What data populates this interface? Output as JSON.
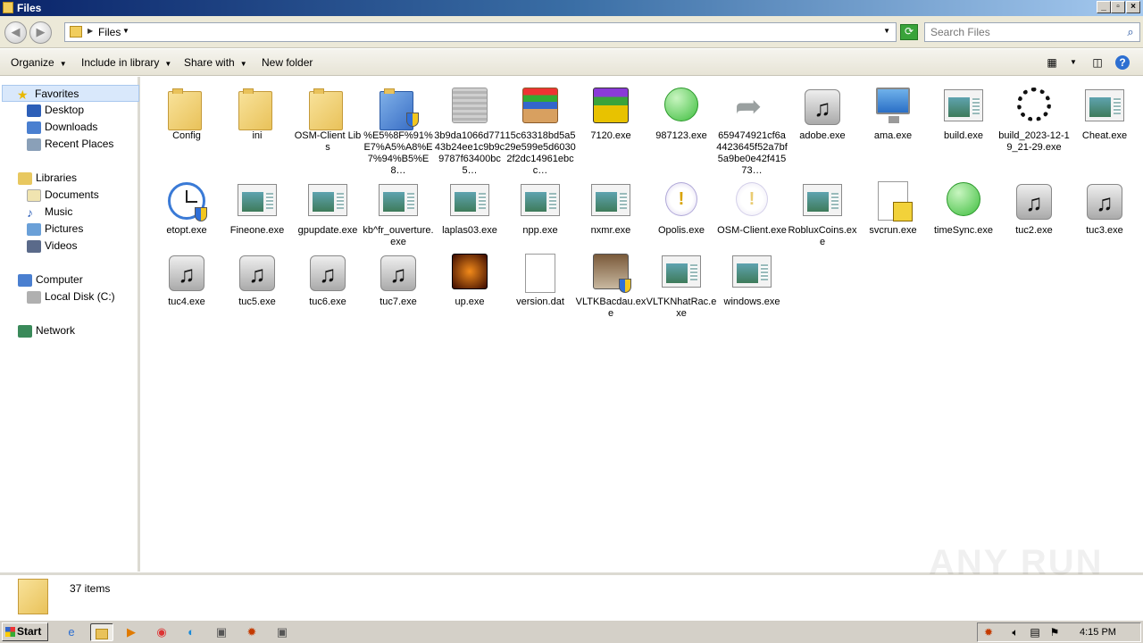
{
  "window": {
    "title": "Files"
  },
  "address": {
    "crumb": "Files",
    "search_placeholder": "Search Files"
  },
  "toolbar": {
    "organize": "Organize",
    "include_in_library": "Include in library",
    "share_with": "Share with",
    "new_folder": "New folder"
  },
  "nav": {
    "favorites": "Favorites",
    "desktop": "Desktop",
    "downloads": "Downloads",
    "recent_places": "Recent Places",
    "libraries": "Libraries",
    "documents": "Documents",
    "music": "Music",
    "pictures": "Pictures",
    "videos": "Videos",
    "computer": "Computer",
    "local_disk": "Local Disk (C:)",
    "network": "Network"
  },
  "files": [
    {
      "name": "Config",
      "icon": "folder"
    },
    {
      "name": "ini",
      "icon": "folder"
    },
    {
      "name": "OSM-Client Libs",
      "icon": "folder"
    },
    {
      "name": "%E5%8F%91%E7%A5%A8%E7%94%B5%E8…",
      "icon": "shield-folder"
    },
    {
      "name": "3b9da1066d77143b24ee1c9b9c9787f63400bc5…",
      "icon": "gray-app"
    },
    {
      "name": "15c63318bd5a529e599e5d60302f2dc14961ebcc…",
      "icon": "archive"
    },
    {
      "name": "7120.exe",
      "icon": "winrar"
    },
    {
      "name": "987123.exe",
      "icon": "green-circle"
    },
    {
      "name": "659474921cf6a4423645f52a7bf5a9be0e42f41573…",
      "icon": "shortcut-arrow"
    },
    {
      "name": "adobe.exe",
      "icon": "music"
    },
    {
      "name": "ama.exe",
      "icon": "monitor"
    },
    {
      "name": "build.exe",
      "icon": "app"
    },
    {
      "name": "build_2023-12-19_21-29.exe",
      "icon": "spinner"
    },
    {
      "name": "Cheat.exe",
      "icon": "app"
    },
    {
      "name": "etopt.exe",
      "icon": "clock"
    },
    {
      "name": "Fineone.exe",
      "icon": "app"
    },
    {
      "name": "gpupdate.exe",
      "icon": "app"
    },
    {
      "name": "kb^fr_ouverture.exe",
      "icon": "app"
    },
    {
      "name": "laplas03.exe",
      "icon": "app"
    },
    {
      "name": "npp.exe",
      "icon": "app"
    },
    {
      "name": "nxmr.exe",
      "icon": "app"
    },
    {
      "name": "Opolis.exe",
      "icon": "warning"
    },
    {
      "name": "OSM-Client.exe",
      "icon": "warning-faded"
    },
    {
      "name": "RobluxCoins.exe",
      "icon": "app"
    },
    {
      "name": "svcrun.exe",
      "icon": "house-doc"
    },
    {
      "name": "timeSync.exe",
      "icon": "green-circle"
    },
    {
      "name": "tuc2.exe",
      "icon": "music"
    },
    {
      "name": "tuc3.exe",
      "icon": "music"
    },
    {
      "name": "tuc4.exe",
      "icon": "music"
    },
    {
      "name": "tuc5.exe",
      "icon": "music"
    },
    {
      "name": "tuc6.exe",
      "icon": "music"
    },
    {
      "name": "tuc7.exe",
      "icon": "music"
    },
    {
      "name": "up.exe",
      "icon": "game-orange"
    },
    {
      "name": "version.dat",
      "icon": "blank-doc"
    },
    {
      "name": "VLTKBacdau.exe",
      "icon": "knight"
    },
    {
      "name": "VLTKNhatRac.exe",
      "icon": "app"
    },
    {
      "name": "windows.exe",
      "icon": "app"
    }
  ],
  "details": {
    "count": "37 items"
  },
  "taskbar": {
    "start": "Start",
    "clock": "4:15 PM"
  },
  "watermark": "ANY RUN"
}
